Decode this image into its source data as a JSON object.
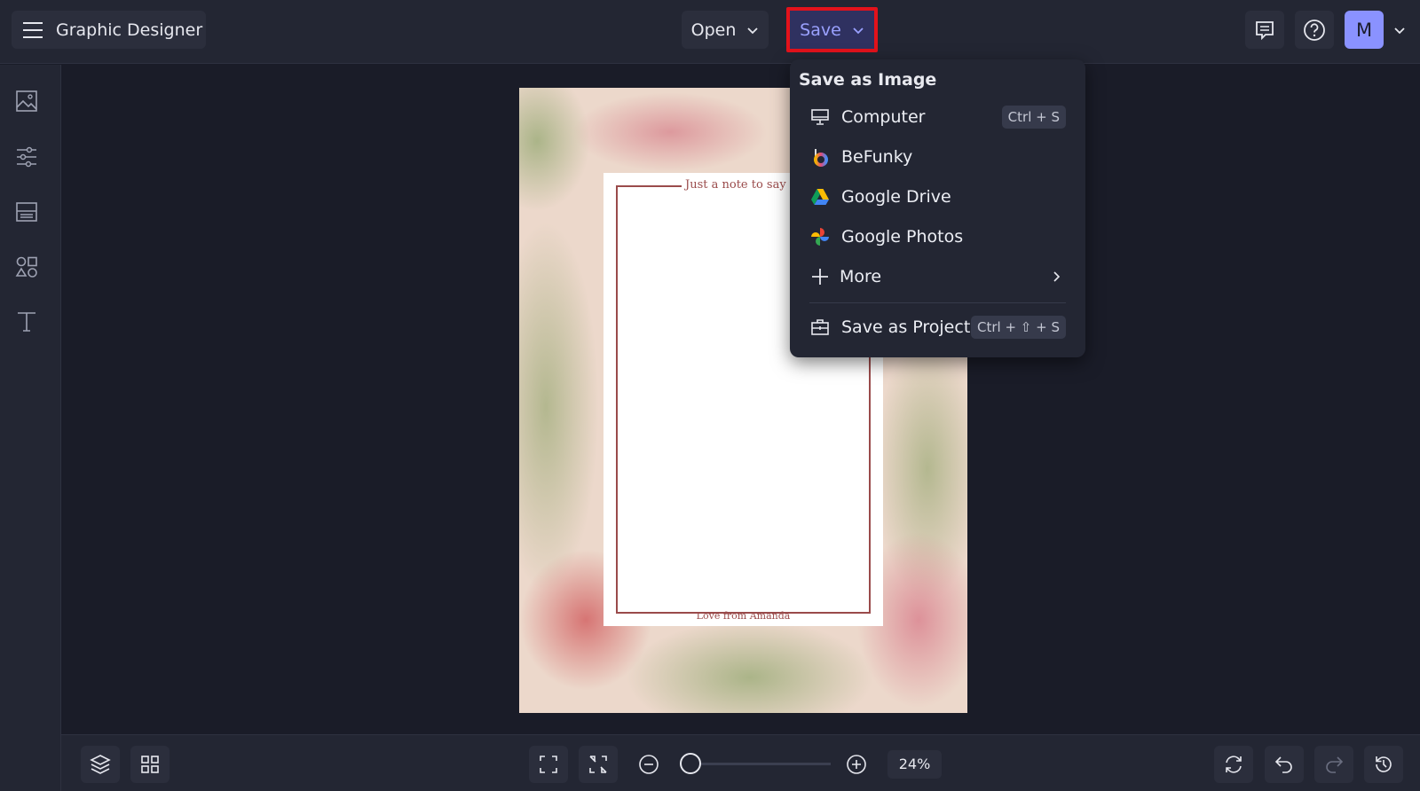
{
  "header": {
    "app_title": "Graphic Designer",
    "open_label": "Open",
    "save_label": "Save",
    "avatar_initial": "M"
  },
  "save_menu": {
    "heading": "Save as Image",
    "items": [
      {
        "label": "Computer",
        "shortcut": "Ctrl + S",
        "icon": "monitor-icon"
      },
      {
        "label": "BeFunky",
        "icon": "befunky-icon"
      },
      {
        "label": "Google Drive",
        "icon": "google-drive-icon"
      },
      {
        "label": "Google Photos",
        "icon": "google-photos-icon"
      },
      {
        "label": "More",
        "icon": "plus-icon"
      }
    ],
    "project": {
      "label": "Save as Project",
      "shortcut": "Ctrl + ⇧ + S",
      "icon": "briefcase-icon"
    }
  },
  "design": {
    "top_text": "Just a note to say",
    "bottom_text": "Love from Amanda"
  },
  "zoom": {
    "percent_label": "24%",
    "value_percent": 24
  },
  "colors": {
    "accent": "#8a92ff",
    "highlight": "#e3121b",
    "save_bg": "#2f3160"
  }
}
